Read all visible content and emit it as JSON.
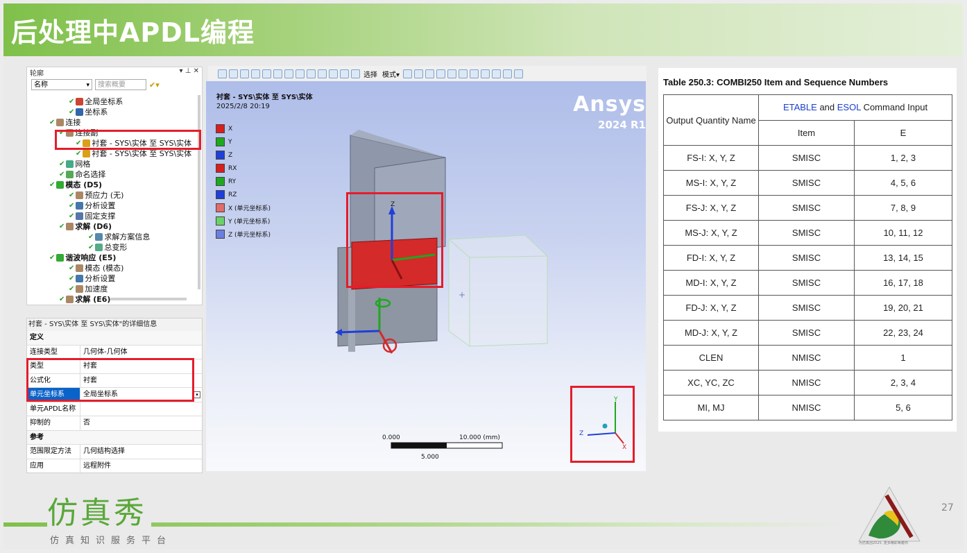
{
  "slide": {
    "title": "后处理中APDL编程",
    "page_number": "27"
  },
  "tree_panel": {
    "header_left": "轮廓",
    "header_icons": "▾ ⊥ ✕",
    "filter_select": "名称",
    "search_placeholder": "搜索概要",
    "items": [
      {
        "label": "全局坐标系",
        "bold": false
      },
      {
        "label": "坐标系",
        "bold": false
      },
      {
        "label": "连接",
        "bold": false
      },
      {
        "label": "连接副",
        "bold": false
      },
      {
        "label": "衬套 - SYS\\实体 至 SYS\\实体",
        "bold": false
      },
      {
        "label": "衬套 - SYS\\实体 至 SYS\\实体",
        "bold": false
      },
      {
        "label": "网格",
        "bold": false
      },
      {
        "label": "命名选择",
        "bold": false
      },
      {
        "label": "模态 (D5)",
        "bold": true
      },
      {
        "label": "预应力 (无)",
        "bold": false
      },
      {
        "label": "分析设置",
        "bold": false
      },
      {
        "label": "固定支撑",
        "bold": false
      },
      {
        "label": "求解 (D6)",
        "bold": true
      },
      {
        "label": "求解方案信息",
        "bold": false
      },
      {
        "label": "总变形",
        "bold": false
      },
      {
        "label": "谐波响应 (E5)",
        "bold": true
      },
      {
        "label": "模态 (模态)",
        "bold": false
      },
      {
        "label": "分析设置",
        "bold": false
      },
      {
        "label": "加速度",
        "bold": false
      },
      {
        "label": "求解 (E6)",
        "bold": true
      }
    ]
  },
  "details_panel": {
    "header": "衬套 - SYS\\实体 至 SYS\\实体\"的详细信息",
    "header_icons": "▾ ⊥ ✕",
    "rows": [
      {
        "key": "定义",
        "value": "",
        "section": true
      },
      {
        "key": "连接类型",
        "value": "几何体-几何体"
      },
      {
        "key": "类型",
        "value": "衬套"
      },
      {
        "key": "公式化",
        "value": "衬套"
      },
      {
        "key": "单元坐标系",
        "value": "全局坐标系",
        "selected": true
      },
      {
        "key": "单元APDL名称",
        "value": ""
      },
      {
        "key": "抑制的",
        "value": "否"
      },
      {
        "key": "参考",
        "value": "",
        "section": true
      },
      {
        "key": "范围限定方法",
        "value": "几何结构选择"
      },
      {
        "key": "应用",
        "value": "远程附件"
      }
    ]
  },
  "toolbar": {
    "select_label": "选择",
    "mode_label": "模式▾"
  },
  "viewport": {
    "title": "衬套 - SYS\\实体 至 SYS\\实体",
    "date": "2025/2/8 20:19",
    "brand": "Ansys",
    "version": "2024 R1",
    "legend": [
      {
        "label": "X",
        "color": "#d91e1e"
      },
      {
        "label": "Y",
        "color": "#1ea81e"
      },
      {
        "label": "Z",
        "color": "#1e3fd9"
      },
      {
        "label": "RX",
        "color": "#d91e1e"
      },
      {
        "label": "RY",
        "color": "#1ea81e"
      },
      {
        "label": "RZ",
        "color": "#1e3fd9"
      },
      {
        "label": "X (单元坐标系)",
        "color": "#e26b6b"
      },
      {
        "label": "Y (单元坐标系)",
        "color": "#6bd26b"
      },
      {
        "label": "Z (单元坐标系)",
        "color": "#6b7fe2"
      }
    ],
    "scale": {
      "left": "0.000",
      "right": "10.000 (mm)",
      "mid": "5.000"
    },
    "triad": {
      "x": "X",
      "y": "Y",
      "z": "Z"
    },
    "axis_labels": {
      "z": "Z",
      "y": "Y",
      "x": "X"
    }
  },
  "table": {
    "caption": "Table 250.3: COMBI250 Item and Sequence Numbers",
    "header_col1": "Output Quantity Name",
    "header_group_parts": [
      "ETABLE",
      " and ",
      "ESOL",
      " Command Input"
    ],
    "header_item": "Item",
    "header_e": "E",
    "rows": [
      {
        "name": "FS-I: X, Y, Z",
        "item": "SMISC",
        "e": "1, 2, 3"
      },
      {
        "name": "MS-I: X, Y, Z",
        "item": "SMISC",
        "e": "4, 5, 6"
      },
      {
        "name": "FS-J: X, Y, Z",
        "item": "SMISC",
        "e": "7, 8, 9"
      },
      {
        "name": "MS-J: X, Y, Z",
        "item": "SMISC",
        "e": "10, 11, 12"
      },
      {
        "name": "FD-I: X, Y, Z",
        "item": "SMISC",
        "e": "13, 14, 15"
      },
      {
        "name": "MD-I: X, Y, Z",
        "item": "SMISC",
        "e": "16, 17, 18"
      },
      {
        "name": "FD-J: X, Y, Z",
        "item": "SMISC",
        "e": "19, 20, 21"
      },
      {
        "name": "MD-J: X, Y, Z",
        "item": "SMISC",
        "e": "22, 23, 24"
      },
      {
        "name": "CLEN",
        "item": "NMISC",
        "e": "1"
      },
      {
        "name": "XC, YC, ZC",
        "item": "NMISC",
        "e": "2, 3, 4"
      },
      {
        "name": "MI, MJ",
        "item": "NMISC",
        "e": "5, 6"
      }
    ]
  },
  "footer": {
    "logo": "仿真秀",
    "tagline": "仿真知识服务平台",
    "corner_text": "为仿真创2025, 更多精彩等着你"
  },
  "colors": {
    "accent_green": "#7fc04a",
    "highlight_red": "#e41d2b",
    "table_blue": "#1a3fc8"
  }
}
